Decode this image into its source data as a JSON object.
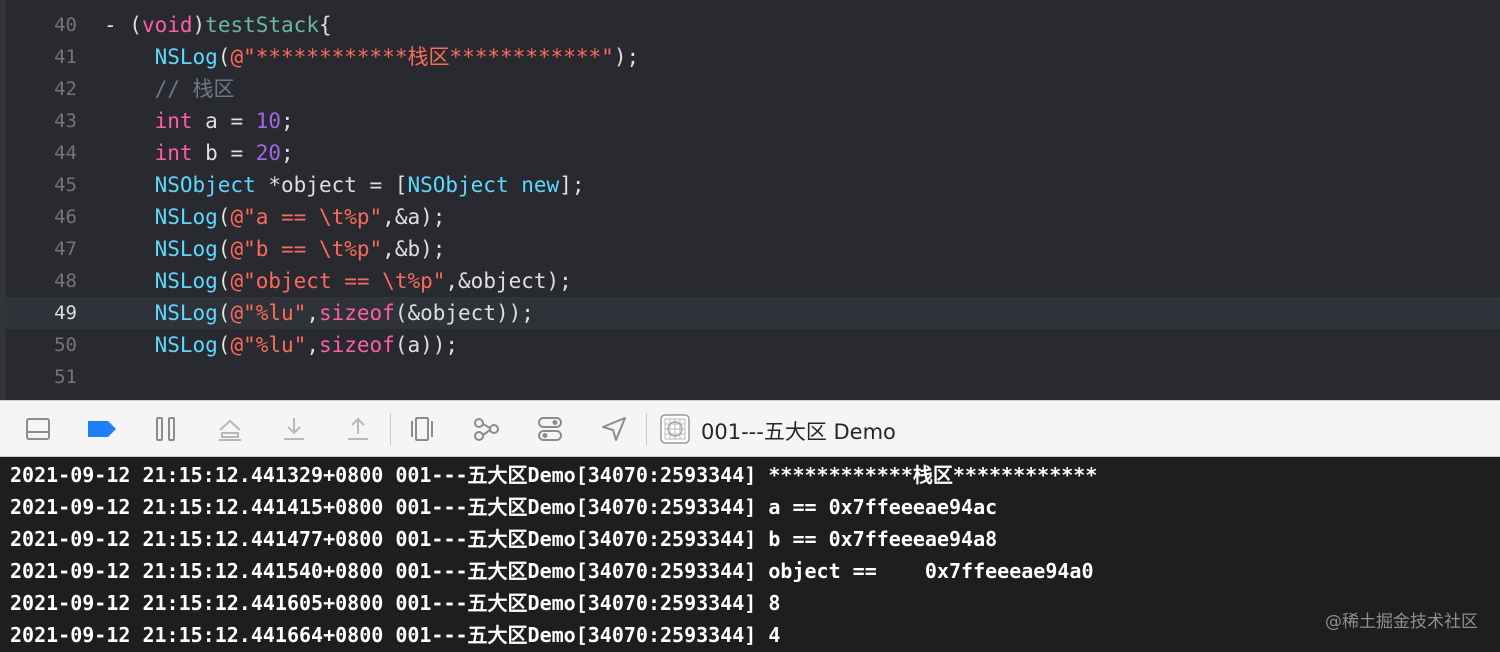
{
  "editor": {
    "lines": [
      {
        "num": "40",
        "current": false,
        "tokens": [
          {
            "c": "plain",
            "t": "- ("
          },
          {
            "c": "kw",
            "t": "void"
          },
          {
            "c": "plain",
            "t": ")"
          },
          {
            "c": "fn",
            "t": "testStack"
          },
          {
            "c": "plain",
            "t": "{"
          }
        ]
      },
      {
        "num": "41",
        "current": false,
        "tokens": [
          {
            "c": "plain",
            "t": "    "
          },
          {
            "c": "type",
            "t": "NSLog"
          },
          {
            "c": "plain",
            "t": "("
          },
          {
            "c": "str",
            "t": "@\"************栈区************\""
          },
          {
            "c": "plain",
            "t": ");"
          }
        ]
      },
      {
        "num": "42",
        "current": false,
        "tokens": [
          {
            "c": "plain",
            "t": "    "
          },
          {
            "c": "cmt",
            "t": "// 栈区"
          }
        ]
      },
      {
        "num": "43",
        "current": false,
        "tokens": [
          {
            "c": "plain",
            "t": "    "
          },
          {
            "c": "kw",
            "t": "int"
          },
          {
            "c": "plain",
            "t": " a = "
          },
          {
            "c": "new",
            "t": "10"
          },
          {
            "c": "plain",
            "t": ";"
          }
        ]
      },
      {
        "num": "44",
        "current": false,
        "tokens": [
          {
            "c": "plain",
            "t": "    "
          },
          {
            "c": "kw",
            "t": "int"
          },
          {
            "c": "plain",
            "t": " b = "
          },
          {
            "c": "new",
            "t": "20"
          },
          {
            "c": "plain",
            "t": ";"
          }
        ]
      },
      {
        "num": "45",
        "current": false,
        "tokens": [
          {
            "c": "plain",
            "t": "    "
          },
          {
            "c": "type",
            "t": "NSObject"
          },
          {
            "c": "plain",
            "t": " *object = ["
          },
          {
            "c": "type",
            "t": "NSObject"
          },
          {
            "c": "plain",
            "t": " "
          },
          {
            "c": "type",
            "t": "new"
          },
          {
            "c": "plain",
            "t": "];"
          }
        ]
      },
      {
        "num": "46",
        "current": false,
        "tokens": [
          {
            "c": "plain",
            "t": "    "
          },
          {
            "c": "type",
            "t": "NSLog"
          },
          {
            "c": "plain",
            "t": "("
          },
          {
            "c": "str",
            "t": "@\"a == \\t%p\""
          },
          {
            "c": "plain",
            "t": ",&a);"
          }
        ]
      },
      {
        "num": "47",
        "current": false,
        "tokens": [
          {
            "c": "plain",
            "t": "    "
          },
          {
            "c": "type",
            "t": "NSLog"
          },
          {
            "c": "plain",
            "t": "("
          },
          {
            "c": "str",
            "t": "@\"b == \\t%p\""
          },
          {
            "c": "plain",
            "t": ",&b);"
          }
        ]
      },
      {
        "num": "48",
        "current": false,
        "tokens": [
          {
            "c": "plain",
            "t": "    "
          },
          {
            "c": "type",
            "t": "NSLog"
          },
          {
            "c": "plain",
            "t": "("
          },
          {
            "c": "str",
            "t": "@\"object == \\t%p\""
          },
          {
            "c": "plain",
            "t": ",&object);"
          }
        ]
      },
      {
        "num": "49",
        "current": true,
        "tokens": [
          {
            "c": "plain",
            "t": "    "
          },
          {
            "c": "type",
            "t": "NSLog"
          },
          {
            "c": "plain",
            "t": "("
          },
          {
            "c": "str",
            "t": "@\"%lu\""
          },
          {
            "c": "plain",
            "t": ","
          },
          {
            "c": "kw",
            "t": "sizeof"
          },
          {
            "c": "plain",
            "t": "(&object));"
          }
        ]
      },
      {
        "num": "50",
        "current": false,
        "tokens": [
          {
            "c": "plain",
            "t": "    "
          },
          {
            "c": "type",
            "t": "NSLog"
          },
          {
            "c": "plain",
            "t": "("
          },
          {
            "c": "str",
            "t": "@\"%lu\""
          },
          {
            "c": "plain",
            "t": ","
          },
          {
            "c": "kw",
            "t": "sizeof"
          },
          {
            "c": "plain",
            "t": "(a));"
          }
        ]
      },
      {
        "num": "51",
        "current": false,
        "tokens": []
      }
    ]
  },
  "debug_bar": {
    "buttons": [
      {
        "name": "hide-debug-area-icon"
      },
      {
        "name": "breakpoints-toggle-icon"
      },
      {
        "name": "pause-icon"
      },
      {
        "name": "step-over-icon"
      },
      {
        "name": "step-into-icon"
      },
      {
        "name": "step-out-icon"
      },
      {
        "name": "view-hierarchy-icon"
      },
      {
        "name": "memory-graph-icon"
      },
      {
        "name": "environment-overrides-icon"
      },
      {
        "name": "simulate-location-icon"
      }
    ],
    "scheme_label": "001---五大区 Demo",
    "colors": {
      "active_button": "#1f7ff7",
      "icon": "#8c8c8c"
    }
  },
  "console": {
    "lines": [
      "2021-09-12 21:15:12.441329+0800 001---五大区Demo[34070:2593344] ************栈区************",
      "2021-09-12 21:15:12.441415+0800 001---五大区Demo[34070:2593344] a == 0x7ffeeeae94ac",
      "2021-09-12 21:15:12.441477+0800 001---五大区Demo[34070:2593344] b == 0x7ffeeeae94a8",
      "2021-09-12 21:15:12.441540+0800 001---五大区Demo[34070:2593344] object ==    0x7ffeeeae94a0",
      "2021-09-12 21:15:12.441605+0800 001---五大区Demo[34070:2593344] 8",
      "2021-09-12 21:15:12.441664+0800 001---五大区Demo[34070:2593344] 4"
    ],
    "watermark": "@稀土掘金技术社区"
  }
}
